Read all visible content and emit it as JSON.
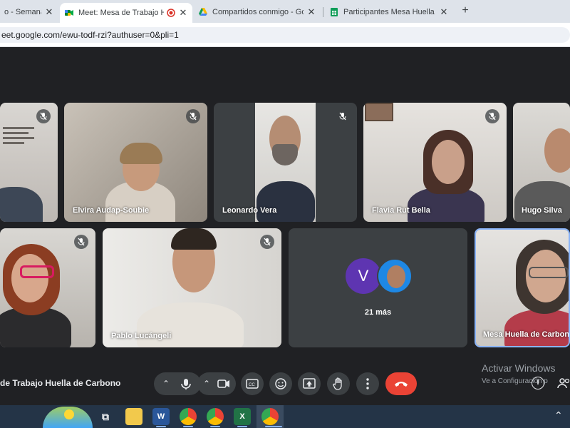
{
  "tabs": [
    {
      "title": "o - Semana d",
      "icon": "calendar-icon"
    },
    {
      "title": "Meet: Mesa de Trabajo Hue",
      "icon": "meet-icon",
      "recording": true
    },
    {
      "title": "Compartidos conmigo - Google",
      "icon": "drive-icon"
    },
    {
      "title": "Participantes Mesa Huella de C",
      "icon": "sheets-icon"
    }
  ],
  "new_tab_label": "+",
  "url": "eet.google.com/ewu-todf-rzi?authuser=0&pli=1",
  "participants": [
    {
      "name": ""
    },
    {
      "name": "Elvira Audap-Soubie"
    },
    {
      "name": "Leonardo Vera"
    },
    {
      "name": "Flavia Rut Bella"
    },
    {
      "name": "Hugo Silva"
    },
    {
      "name": ""
    },
    {
      "name": "Pablo Lucángeli"
    },
    {
      "name": "Mesa Huella de Carbono"
    }
  ],
  "more_tile": {
    "avatar_letter": "V",
    "more_label": "21 más"
  },
  "meeting_title": "de Trabajo Huella de Carbono",
  "watermark": {
    "line1": "Activar Windows",
    "line2": "Ve a Configuración p"
  },
  "colors": {
    "accent_blue": "#8ab4f8",
    "hangup_red": "#ea4335",
    "avatar_purple": "#5e35b1",
    "stage_bg": "#202124"
  }
}
